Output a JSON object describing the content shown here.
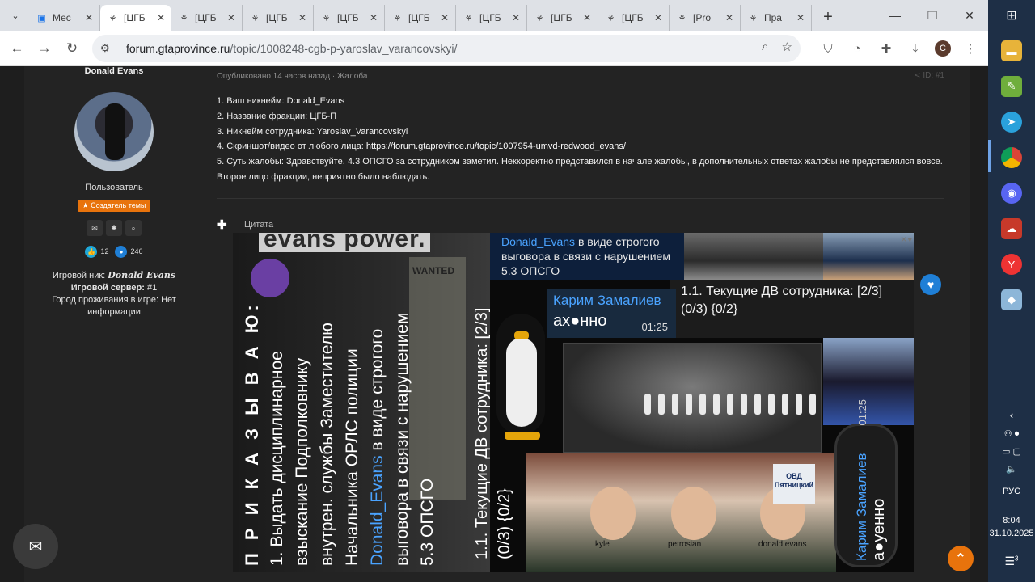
{
  "browser": {
    "tabs": [
      {
        "title": "Мес",
        "favicon": "chat-icon",
        "active": false
      },
      {
        "title": "[ЦГБ",
        "favicon": "forum-icon",
        "active": true
      },
      {
        "title": "[ЦГБ",
        "favicon": "forum-icon",
        "active": false
      },
      {
        "title": "[ЦГБ",
        "favicon": "forum-icon",
        "active": false
      },
      {
        "title": "[ЦГБ",
        "favicon": "forum-icon",
        "active": false
      },
      {
        "title": "[ЦГБ",
        "favicon": "forum-icon",
        "active": false
      },
      {
        "title": "[ЦГБ",
        "favicon": "forum-icon",
        "active": false
      },
      {
        "title": "[ЦГБ",
        "favicon": "forum-icon",
        "active": false
      },
      {
        "title": "[ЦГБ",
        "favicon": "forum-icon",
        "active": false
      },
      {
        "title": "[Pro",
        "favicon": "forum-icon",
        "active": false
      },
      {
        "title": "Пра",
        "favicon": "forum-icon",
        "active": false
      }
    ],
    "url_domain": "forum.gtaprovince.ru",
    "url_path": "/topic/1008248-cgb-p-yaroslav_varancovskyi/",
    "profile_initial": "C"
  },
  "author": {
    "name": "Donald Evans",
    "role": "Пользователь",
    "badge": "★ Создатель темы",
    "reputation_count": "12",
    "posts_count": "246",
    "ingame_nick_label": "Игровой ник:",
    "ingame_nick": "Donald Evans",
    "server_label": "Игровой сервер:",
    "server": "#1",
    "city_label": "Город проживания в игре:",
    "city": "Нет информации"
  },
  "post": {
    "meta": "Опубликовано 14 часов назад · Жалоба",
    "post_id": "ID: #1",
    "lines": [
      "1. Ваш никнейм: Donald_Evans",
      "2. Название фракции: ЦГБ-П",
      "3. Никнейм сотрудника: Yaroslav_Varancovskyi"
    ],
    "line4_label": "4. Скриншот/видео от любого лица: ",
    "line4_link": "https://forum.gtaprovince.ru/topic/1007954-umvd-redwood_evans/",
    "line5": "5. Суть жалобы: Здравствуйте. 4.3 ОПСГО за сотрудником заметил. Неккоректно представился в начале жалобы, в дополнительных ответах жалобы не представлялся вовсе. Второе лицо фракции, неприятно было наблюдать.",
    "quote_label": "Цитата"
  },
  "collage": {
    "title": "evans power.",
    "wanted": "WANTED",
    "order_heading": "П Р И К А З Ы В А Ю:",
    "order_lines": [
      "1. Выдать дисциплинарное",
      "взыскание Подполковнику",
      "внутрен. службы Заместителю",
      "Начальника ОРЛС полиции"
    ],
    "order_name": "Donald_Evans",
    "order_tail": " в виде строгого",
    "order_more": [
      "выговора в связи с нарушением",
      "5.3 ОПСГО"
    ],
    "order_stat": [
      "1.1. Текущие ДВ сотрудника: [2/3]",
      "(0/3) {0/2}"
    ],
    "chat_name": "Donald_Evans",
    "chat_text": " в виде строгого выговора в связи с нарушением 5.3 ОПСГО",
    "stat_lines": [
      "1.1. Текущие ДВ сотрудника: [2/3]",
      "(0/3) {0/2}"
    ],
    "voice_name": "Карим Замалиев",
    "voice_text": "ах●нно",
    "voice_time": "01:25",
    "sign_text": "ОВД Пятницкий",
    "names": [
      "kyle",
      "petrosian",
      "donald evans"
    ],
    "phone_name": "Карим Замалиев",
    "phone_text": "а●уенно",
    "phone_time": "01:25"
  },
  "taskbar": {
    "language": "РУС",
    "time": "8:04",
    "date": "31.10.2025",
    "notifications": "3"
  }
}
